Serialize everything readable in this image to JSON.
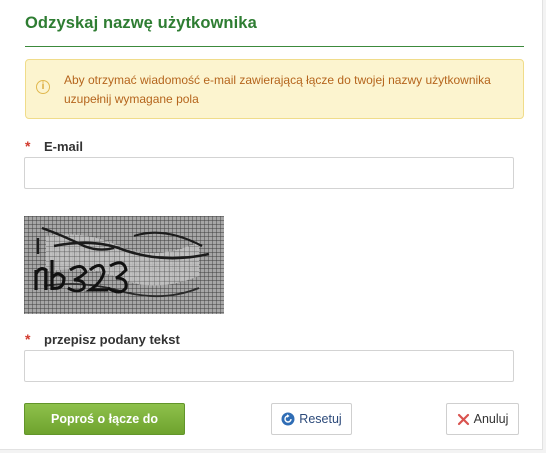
{
  "form": {
    "title": "Odzyskaj nazwę użytkownika",
    "alert": {
      "icon": "info-circle-icon",
      "text": "Aby otrzymać wiadomość e-mail zawierającą łącze do twojej nazwy użytkownika uzupełnij wymagane pola"
    },
    "email": {
      "required_mark": "*",
      "label": "E-mail",
      "value": "",
      "placeholder": ""
    },
    "captcha": {
      "image_text": "nb323",
      "required_mark": "*",
      "label": "przepisz podany tekst",
      "value": "",
      "placeholder": ""
    },
    "buttons": {
      "submit_label": "Poproś o łącze do",
      "reset_label": "Resetuj",
      "reset_icon": "refresh-icon",
      "cancel_label": "Anuluj",
      "cancel_icon": "close-icon"
    }
  },
  "colors": {
    "title_green": "#2e7d32",
    "alert_bg": "#fcf4cf",
    "alert_text": "#b5651d",
    "required_red": "#d23a2e",
    "primary_button": "#7cb23a",
    "reset_icon_blue": "#2f6db5",
    "cancel_icon_red": "#d9534f"
  }
}
